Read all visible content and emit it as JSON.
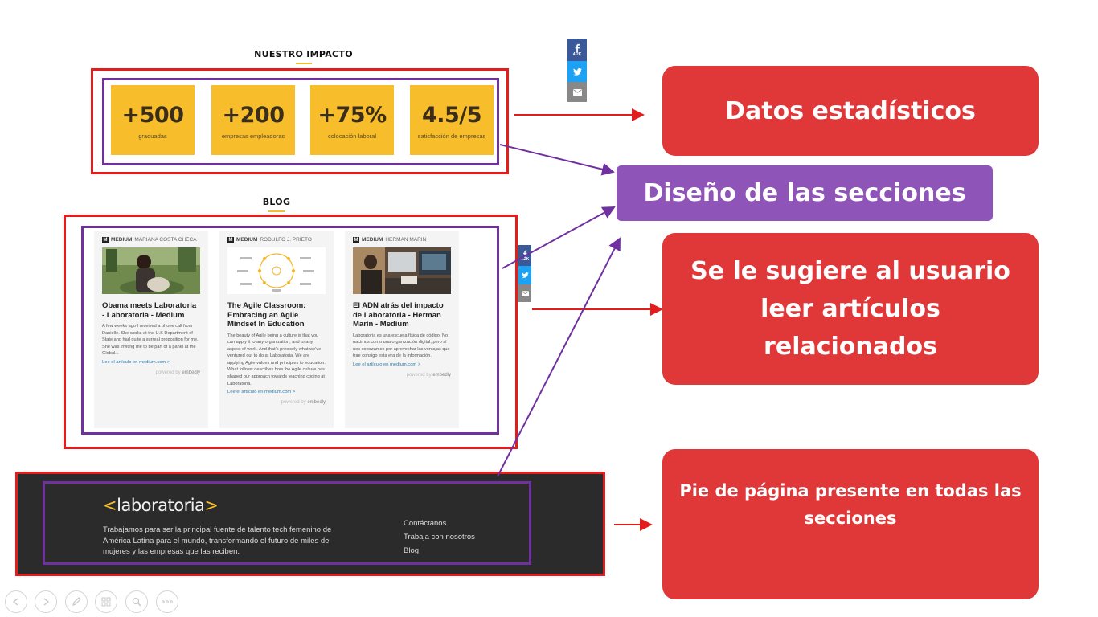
{
  "impact": {
    "title": "NUESTRO IMPACTO",
    "stats": [
      {
        "value": "+500",
        "label": "graduadas"
      },
      {
        "value": "+200",
        "label": "empresas empleadoras"
      },
      {
        "value": "+75%",
        "label": "colocación laboral"
      },
      {
        "value": "4.5/5",
        "label": "satisfacción de empresas"
      }
    ]
  },
  "share_top": {
    "facebook_count": "4.2K"
  },
  "share_blog": {
    "facebook_count": "4.2K"
  },
  "blog": {
    "title": "BLOG",
    "cards": [
      {
        "source": "MEDIUM",
        "author": "MARIANA COSTA CHECA",
        "title": "Obama meets Laboratoria - Laboratoria - Medium",
        "text": "A few weeks ago I received a phone call from Danielle. She works at the U.S Department of State and had quite a surreal proposition for me. She was inviting me to be part of a panel at the Global...",
        "link": "Lee el artículo en medium.com >",
        "powered_a": "powered by",
        "powered_b": "embedly"
      },
      {
        "source": "MEDIUM",
        "author": "RODULFO J. PRIETO",
        "title": "The Agile Classroom: Embracing an Agile Mindset In Education",
        "text": "The beauty of Agile being a culture is that you can apply it to any organization, and to any aspect of work. And that's precisely what we've ventured out to do at Laboratoria. We are applying Agile values and principles to education. What follows describes how the Agile culture has shaped our approach towards teaching coding at Laboratoria.",
        "link": "Lee el artículo en medium.com >",
        "powered_a": "powered by",
        "powered_b": "embedly"
      },
      {
        "source": "MEDIUM",
        "author": "HERMAN MARIN",
        "title": "El ADN atrás del impacto de Laboratoria - Herman Marín - Medium",
        "text": "Laboratoria es una escuela física de código. No nacimos como una organización digital, pero sí nos esforzamos por aprovechar las ventajas que trae consigo esta era de la información.",
        "link": "Lee el artículo en medium.com >",
        "powered_a": "powered by",
        "powered_b": "embedly"
      }
    ]
  },
  "footer": {
    "logo_open": "<",
    "logo_text": "laboratoria",
    "logo_close": ">",
    "description": "Trabajamos para ser la principal fuente de talento tech femenino de América Latina para el mundo, transformando el futuro de miles de mujeres y las empresas que las reciben.",
    "links": [
      "Contáctanos",
      "Trabaja con nosotros",
      "Blog"
    ]
  },
  "callouts": {
    "stats": "Datos estadísticos",
    "design": "Diseño de las secciones",
    "related": "Se le sugiere al usuario leer artículos relacionados",
    "footer": "Pie de página presente en todas las secciones"
  },
  "colors": {
    "accent_yellow": "#f7bd2b",
    "annotation_red": "#e31c1c",
    "annotation_purple": "#7030a0",
    "callout_red": "#e03838",
    "callout_purple": "#8e54b8",
    "footer_bg": "#2b2b2b"
  },
  "toolbar_icons": [
    "prev-icon",
    "next-icon",
    "pen-icon",
    "slides-icon",
    "zoom-icon",
    "more-icon"
  ]
}
